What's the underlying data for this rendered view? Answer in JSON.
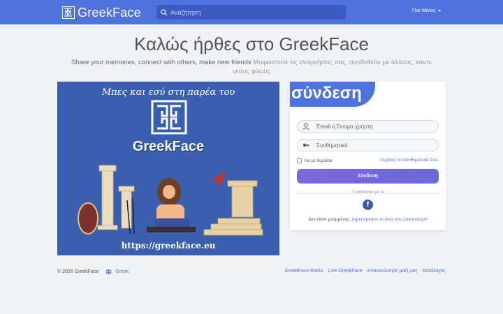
{
  "header": {
    "logo_text": "GreekFace",
    "search_placeholder": "Αναζήτηση",
    "member_label": "Γίνε Μέλος"
  },
  "welcome": {
    "title": "Καλώς ήρθες στο GreekFace",
    "subtitle_en": "Share your memories, connect with others, make new friends",
    "subtitle_gr": "Μοιραστείτε τις αναμνήσεις σας, συνδεθείτε με άλλους, κάντε νέους φίλους"
  },
  "banner": {
    "tagline": "Μπες και εσύ στη παρέα του",
    "name": "GreekFace",
    "url": "https://greekface.eu"
  },
  "login": {
    "title": "σύνδεση",
    "username_placeholder": "Email ή Όνομα χρήστη",
    "password_placeholder": "Συνθηματικό",
    "remember_label": "Να με θυμάσαι",
    "forgot_label": "Ξέχασες το συνθηματικό σου;",
    "button_label": "Σύνδεση",
    "or_label": "ή συνδέσου με το",
    "facebook_letter": "f",
    "no_account_text": "Δεν είσαι γραμμένος;",
    "signup_link": "Δημιούργησε το δικό σου λογαριασμό"
  },
  "footer": {
    "copyright": "© 2026 GreekFace",
    "language": "Greek",
    "links": [
      "GreekFace Radio",
      "Live GreekFace",
      "Επικοινώνησε μαζί μας",
      "Κατάλογος"
    ]
  },
  "colors": {
    "brand": "#4f72de",
    "banner_bg": "#3a5fae",
    "facebook": "#3a5ba0"
  }
}
